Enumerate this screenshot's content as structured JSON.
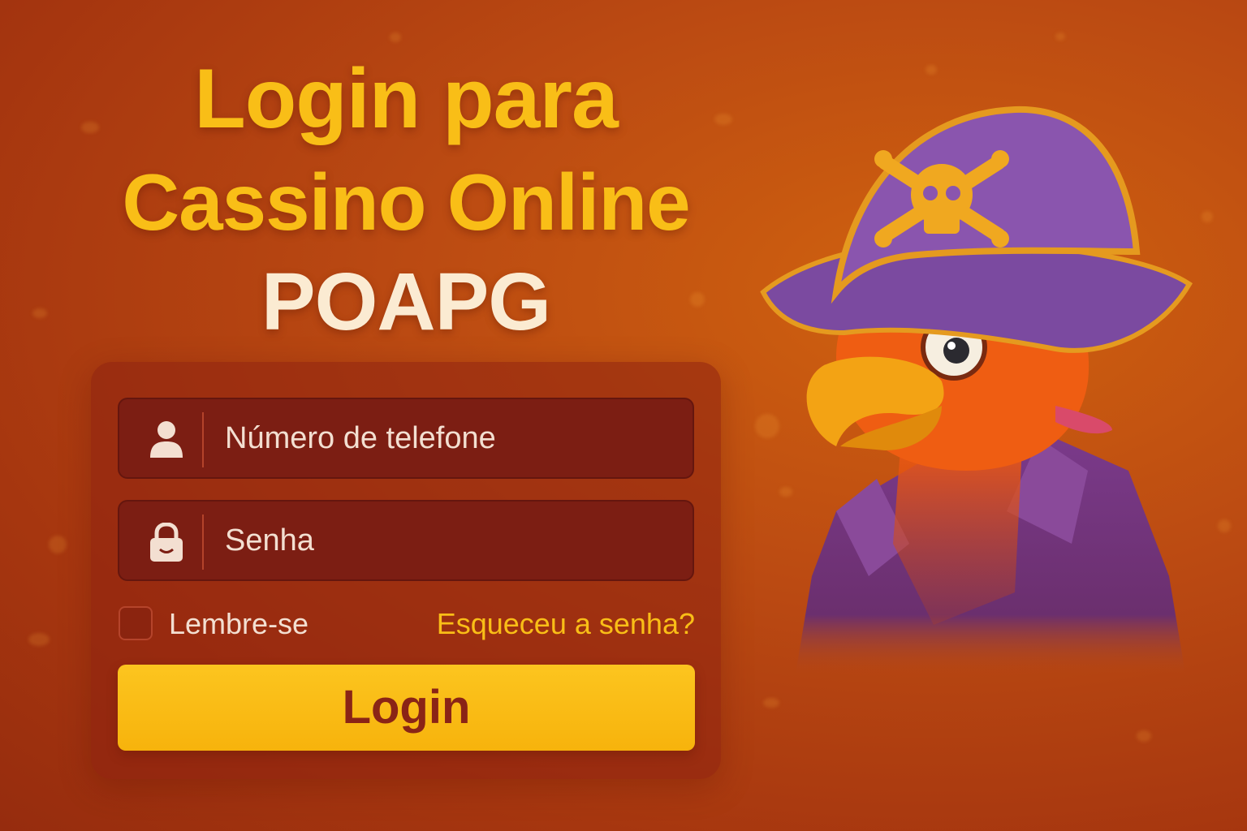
{
  "title": {
    "line1": "Login para",
    "line2": "Cassino Online",
    "line3": "POAPG"
  },
  "form": {
    "phone_placeholder": "Número de telefone",
    "password_placeholder": "Senha",
    "remember_label": "Lembre-se",
    "forgot_link": "Esqueceu a senha?",
    "login_button": "Login"
  },
  "icons": {
    "phone_field": "user-icon",
    "password_field": "lock-icon"
  },
  "mascot": "pirate-parrot",
  "colors": {
    "accent_yellow": "#f9be17",
    "title_cream": "#fbebd2",
    "field_bg": "#7c1e13",
    "button_text": "#8a2416",
    "placeholder_text": "#f3dfd1"
  }
}
